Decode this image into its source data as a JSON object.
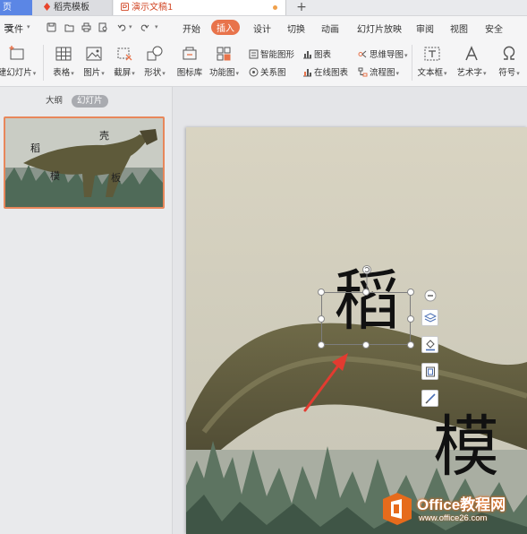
{
  "tabs": {
    "home": "页",
    "templates": "稻壳模板",
    "document": "演示文稿1",
    "new_tab": "+"
  },
  "menu": {
    "file": "文件",
    "items": [
      "开始",
      "插入",
      "设计",
      "切换",
      "动画",
      "幻灯片放映",
      "审阅",
      "视图",
      "安全"
    ],
    "active": "插入"
  },
  "ribbon": {
    "new_slide": "建幻灯片",
    "table": "表格",
    "picture": "图片",
    "screenshot": "截屏",
    "shape": "形状",
    "icon_library": "图标库",
    "function_chart": "功能图",
    "smart_art": "智能图形",
    "relation_chart": "关系图",
    "chart": "图表",
    "online_chart": "在线图表",
    "mind_map": "思维导图",
    "flowchart": "流程图",
    "textbox": "文本框",
    "word_art": "艺术字",
    "symbol": "符号"
  },
  "left_pane": {
    "outline_tab": "大纲",
    "slides_tab": "幻灯片",
    "slide_number": "1",
    "thumb_chars": [
      "稻",
      "壳",
      "模",
      "板"
    ]
  },
  "slide": {
    "char_selected": "稻",
    "char_bottom": "模"
  },
  "watermark": {
    "title": "Office教程网",
    "url": "www.office26.com"
  },
  "colors": {
    "accent": "#e8734b",
    "home_tab": "#5b86e5",
    "arrow": "#e23b30"
  }
}
